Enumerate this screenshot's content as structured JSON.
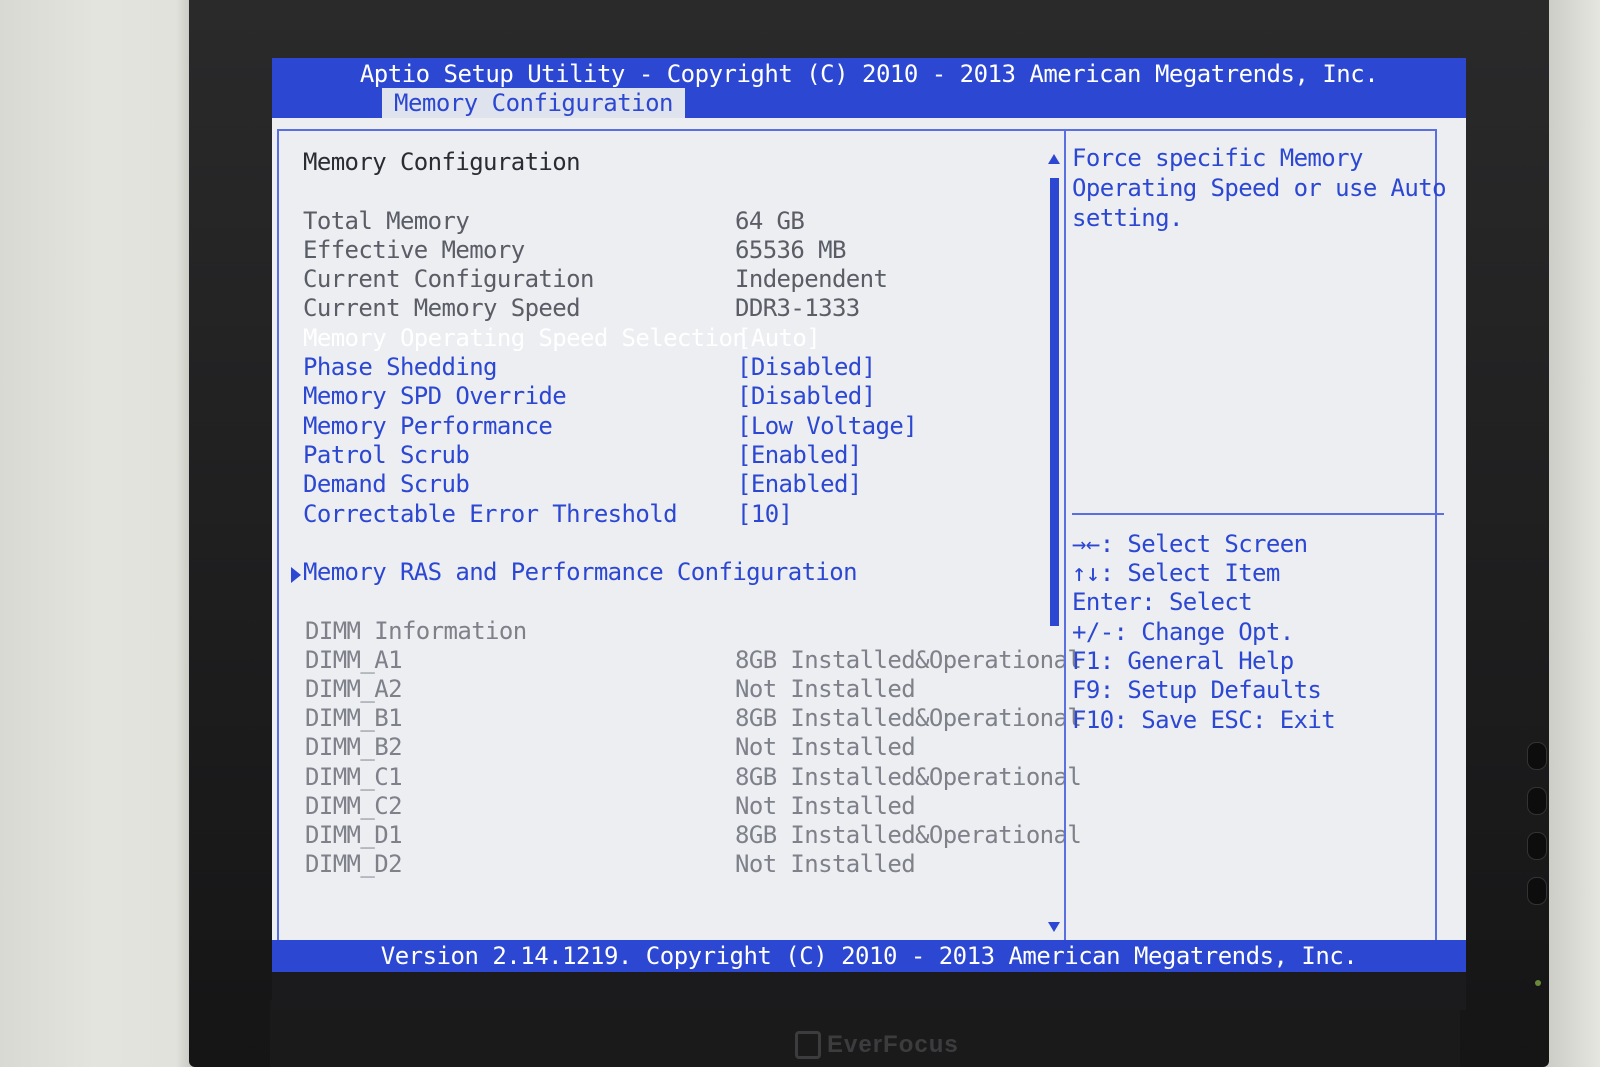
{
  "header": {
    "title": "Aptio Setup Utility - Copyright (C) 2010 - 2013 American Megatrends, Inc.",
    "tab": "Memory Configuration"
  },
  "main": {
    "heading": "Memory Configuration",
    "info": [
      {
        "label": "Total Memory",
        "value": "64 GB"
      },
      {
        "label": "Effective Memory",
        "value": "65536 MB"
      },
      {
        "label": "Current Configuration",
        "value": "Independent"
      },
      {
        "label": "Current Memory Speed",
        "value": "DDR3-1333"
      }
    ],
    "settings": [
      {
        "label": "Memory Operating Speed Selection",
        "value": "[Auto]"
      },
      {
        "label": "Phase Shedding",
        "value": "[Disabled]"
      },
      {
        "label": "Memory SPD Override",
        "value": "[Disabled]"
      },
      {
        "label": "Memory Performance",
        "value": "[Low Voltage]"
      },
      {
        "label": "Patrol Scrub",
        "value": "[Enabled]"
      },
      {
        "label": "Demand Scrub",
        "value": "[Enabled]"
      },
      {
        "label": "Correctable Error Threshold",
        "value": "[10]"
      }
    ],
    "submenu": "Memory RAS and Performance Configuration",
    "dimm_heading": "DIMM Information",
    "dimms": [
      {
        "label": "DIMM_A1",
        "value": "8GB Installed&Operational"
      },
      {
        "label": "DIMM_A2",
        "value": "Not Installed"
      },
      {
        "label": "DIMM_B1",
        "value": "8GB Installed&Operational"
      },
      {
        "label": "DIMM_B2",
        "value": "Not Installed"
      },
      {
        "label": "DIMM_C1",
        "value": "8GB Installed&Operational"
      },
      {
        "label": "DIMM_C2",
        "value": "Not Installed"
      },
      {
        "label": "DIMM_D1",
        "value": "8GB Installed&Operational"
      },
      {
        "label": "DIMM_D2",
        "value": "Not Installed"
      }
    ]
  },
  "help": {
    "description": [
      "Force specific Memory",
      "Operating Speed or use Auto",
      "setting."
    ],
    "keys": [
      "→←: Select Screen",
      "↑↓: Select Item",
      "Enter: Select",
      "+/-: Change Opt.",
      "F1: General Help",
      "F9: Setup Defaults",
      "F10: Save  ESC: Exit"
    ]
  },
  "footer": "Version 2.14.1219. Copyright (C) 2010 - 2013 American Megatrends, Inc.",
  "monitor_brand": "EverFocus",
  "colors": {
    "accent": "#2c47d2",
    "background": "#eceef2",
    "selected_text": "#ffffff"
  }
}
